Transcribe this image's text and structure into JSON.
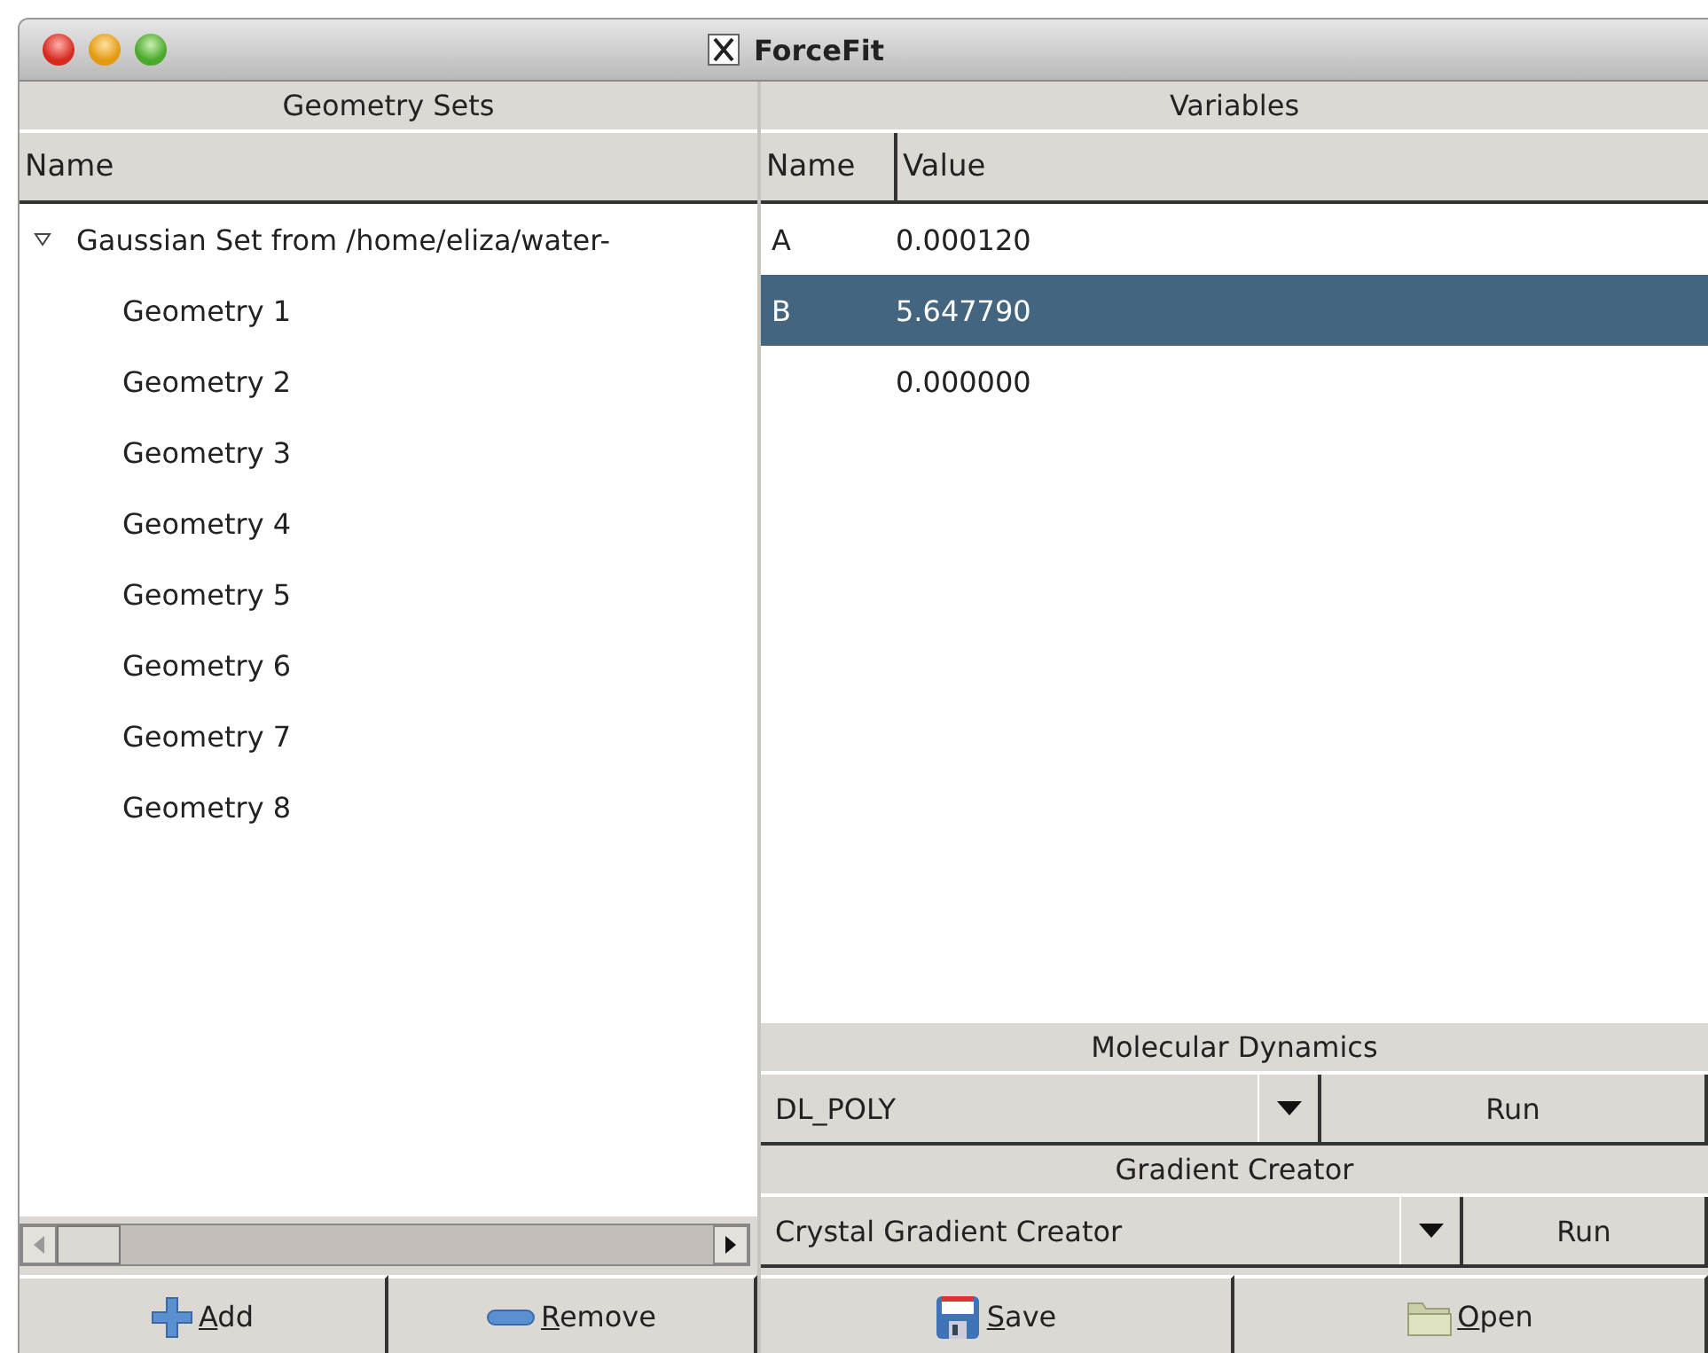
{
  "window": {
    "title": "ForceFit"
  },
  "geometry_sets": {
    "title": "Geometry Sets",
    "column": "Name",
    "tree": [
      {
        "label": "Gaussian Set from /home/eliza/water-",
        "expanded": true,
        "children": [
          {
            "label": "Geometry 1"
          },
          {
            "label": "Geometry 2"
          },
          {
            "label": "Geometry 3"
          },
          {
            "label": "Geometry 4"
          },
          {
            "label": "Geometry 5"
          },
          {
            "label": "Geometry 6"
          },
          {
            "label": "Geometry 7"
          },
          {
            "label": "Geometry 8"
          }
        ]
      }
    ],
    "buttons": [
      {
        "label": "Add",
        "mnemonic_underlined": true,
        "kind": "add"
      },
      {
        "label": "Remove",
        "mnemonic_underlined": true,
        "kind": "remove"
      }
    ]
  },
  "variables": {
    "title": "Variables",
    "columns": [
      "Name",
      "Value"
    ],
    "rows": [
      {
        "name": "A",
        "value": "0.000120",
        "selected": false
      },
      {
        "name": "B",
        "value": "5.647790",
        "selected": true
      },
      {
        "value": "0.000000",
        "selected": false
      }
    ]
  },
  "molecular_dynamics": {
    "title": "Molecular Dynamics",
    "combo": "DL_POLY",
    "run": "Run"
  },
  "gradient_creator": {
    "title": "Gradient Creator",
    "combo": "Crystal Gradient Creator",
    "run": "Run"
  },
  "file_buttons": [
    {
      "label": "Save",
      "mnemonic_underlined": true,
      "kind": "save"
    },
    {
      "label": "Open",
      "mnemonic_underlined": true,
      "kind": "open"
    }
  ]
}
